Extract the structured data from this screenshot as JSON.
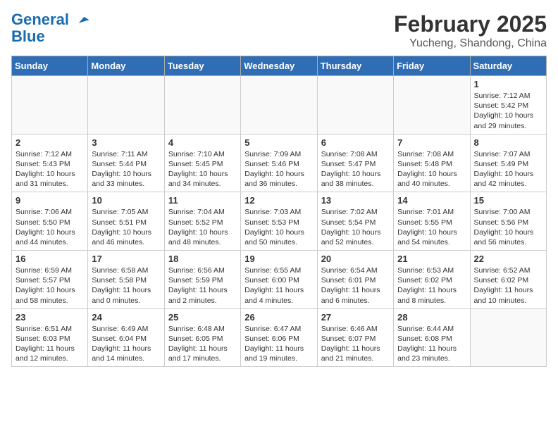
{
  "header": {
    "logo_line1": "General",
    "logo_line2": "Blue",
    "month": "February 2025",
    "location": "Yucheng, Shandong, China"
  },
  "weekdays": [
    "Sunday",
    "Monday",
    "Tuesday",
    "Wednesday",
    "Thursday",
    "Friday",
    "Saturday"
  ],
  "weeks": [
    [
      {
        "day": "",
        "info": ""
      },
      {
        "day": "",
        "info": ""
      },
      {
        "day": "",
        "info": ""
      },
      {
        "day": "",
        "info": ""
      },
      {
        "day": "",
        "info": ""
      },
      {
        "day": "",
        "info": ""
      },
      {
        "day": "1",
        "info": "Sunrise: 7:12 AM\nSunset: 5:42 PM\nDaylight: 10 hours\nand 29 minutes."
      }
    ],
    [
      {
        "day": "2",
        "info": "Sunrise: 7:12 AM\nSunset: 5:43 PM\nDaylight: 10 hours\nand 31 minutes."
      },
      {
        "day": "3",
        "info": "Sunrise: 7:11 AM\nSunset: 5:44 PM\nDaylight: 10 hours\nand 33 minutes."
      },
      {
        "day": "4",
        "info": "Sunrise: 7:10 AM\nSunset: 5:45 PM\nDaylight: 10 hours\nand 34 minutes."
      },
      {
        "day": "5",
        "info": "Sunrise: 7:09 AM\nSunset: 5:46 PM\nDaylight: 10 hours\nand 36 minutes."
      },
      {
        "day": "6",
        "info": "Sunrise: 7:08 AM\nSunset: 5:47 PM\nDaylight: 10 hours\nand 38 minutes."
      },
      {
        "day": "7",
        "info": "Sunrise: 7:08 AM\nSunset: 5:48 PM\nDaylight: 10 hours\nand 40 minutes."
      },
      {
        "day": "8",
        "info": "Sunrise: 7:07 AM\nSunset: 5:49 PM\nDaylight: 10 hours\nand 42 minutes."
      }
    ],
    [
      {
        "day": "9",
        "info": "Sunrise: 7:06 AM\nSunset: 5:50 PM\nDaylight: 10 hours\nand 44 minutes."
      },
      {
        "day": "10",
        "info": "Sunrise: 7:05 AM\nSunset: 5:51 PM\nDaylight: 10 hours\nand 46 minutes."
      },
      {
        "day": "11",
        "info": "Sunrise: 7:04 AM\nSunset: 5:52 PM\nDaylight: 10 hours\nand 48 minutes."
      },
      {
        "day": "12",
        "info": "Sunrise: 7:03 AM\nSunset: 5:53 PM\nDaylight: 10 hours\nand 50 minutes."
      },
      {
        "day": "13",
        "info": "Sunrise: 7:02 AM\nSunset: 5:54 PM\nDaylight: 10 hours\nand 52 minutes."
      },
      {
        "day": "14",
        "info": "Sunrise: 7:01 AM\nSunset: 5:55 PM\nDaylight: 10 hours\nand 54 minutes."
      },
      {
        "day": "15",
        "info": "Sunrise: 7:00 AM\nSunset: 5:56 PM\nDaylight: 10 hours\nand 56 minutes."
      }
    ],
    [
      {
        "day": "16",
        "info": "Sunrise: 6:59 AM\nSunset: 5:57 PM\nDaylight: 10 hours\nand 58 minutes."
      },
      {
        "day": "17",
        "info": "Sunrise: 6:58 AM\nSunset: 5:58 PM\nDaylight: 11 hours\nand 0 minutes."
      },
      {
        "day": "18",
        "info": "Sunrise: 6:56 AM\nSunset: 5:59 PM\nDaylight: 11 hours\nand 2 minutes."
      },
      {
        "day": "19",
        "info": "Sunrise: 6:55 AM\nSunset: 6:00 PM\nDaylight: 11 hours\nand 4 minutes."
      },
      {
        "day": "20",
        "info": "Sunrise: 6:54 AM\nSunset: 6:01 PM\nDaylight: 11 hours\nand 6 minutes."
      },
      {
        "day": "21",
        "info": "Sunrise: 6:53 AM\nSunset: 6:02 PM\nDaylight: 11 hours\nand 8 minutes."
      },
      {
        "day": "22",
        "info": "Sunrise: 6:52 AM\nSunset: 6:02 PM\nDaylight: 11 hours\nand 10 minutes."
      }
    ],
    [
      {
        "day": "23",
        "info": "Sunrise: 6:51 AM\nSunset: 6:03 PM\nDaylight: 11 hours\nand 12 minutes."
      },
      {
        "day": "24",
        "info": "Sunrise: 6:49 AM\nSunset: 6:04 PM\nDaylight: 11 hours\nand 14 minutes."
      },
      {
        "day": "25",
        "info": "Sunrise: 6:48 AM\nSunset: 6:05 PM\nDaylight: 11 hours\nand 17 minutes."
      },
      {
        "day": "26",
        "info": "Sunrise: 6:47 AM\nSunset: 6:06 PM\nDaylight: 11 hours\nand 19 minutes."
      },
      {
        "day": "27",
        "info": "Sunrise: 6:46 AM\nSunset: 6:07 PM\nDaylight: 11 hours\nand 21 minutes."
      },
      {
        "day": "28",
        "info": "Sunrise: 6:44 AM\nSunset: 6:08 PM\nDaylight: 11 hours\nand 23 minutes."
      },
      {
        "day": "",
        "info": ""
      }
    ]
  ]
}
